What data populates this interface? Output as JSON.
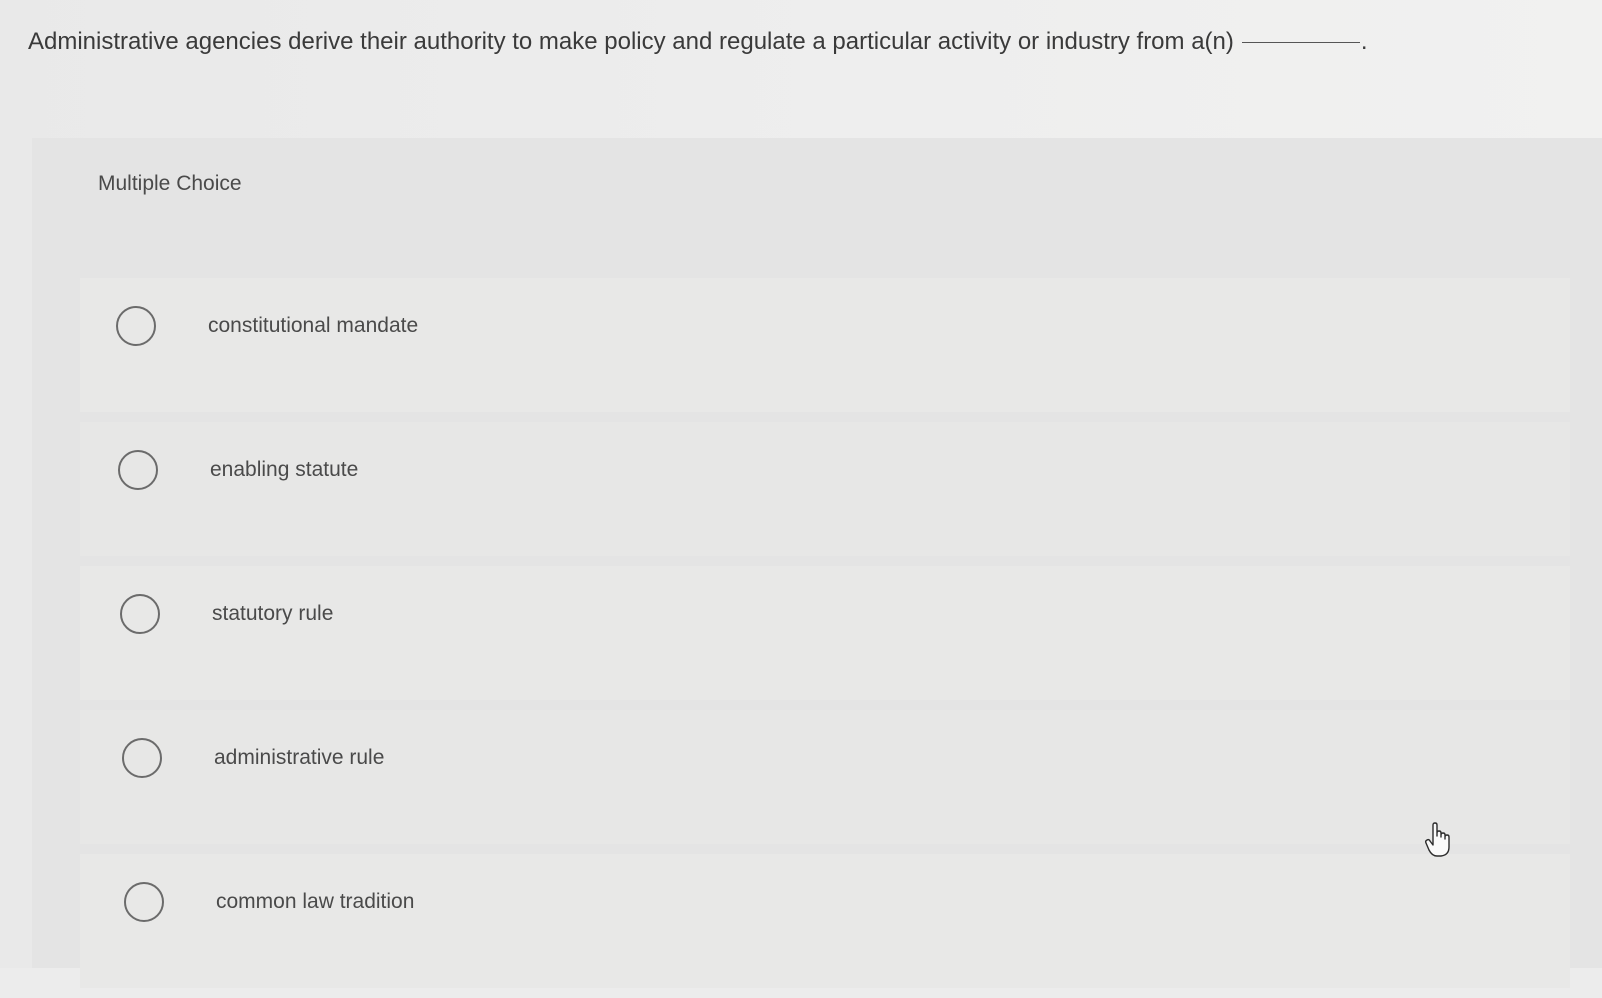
{
  "question": {
    "text": "Administrative agencies derive their authority to make policy and regulate a particular activity or industry from a(n)",
    "blank_suffix": "."
  },
  "card": {
    "title": "Multiple Choice"
  },
  "options": [
    {
      "label": "constitutional mandate",
      "selected": false
    },
    {
      "label": "enabling statute",
      "selected": false
    },
    {
      "label": "statutory rule",
      "selected": false
    },
    {
      "label": "administrative rule",
      "selected": false
    },
    {
      "label": "common law tradition",
      "selected": false
    }
  ],
  "pointer": {
    "icon": "hand-pointer-icon"
  }
}
